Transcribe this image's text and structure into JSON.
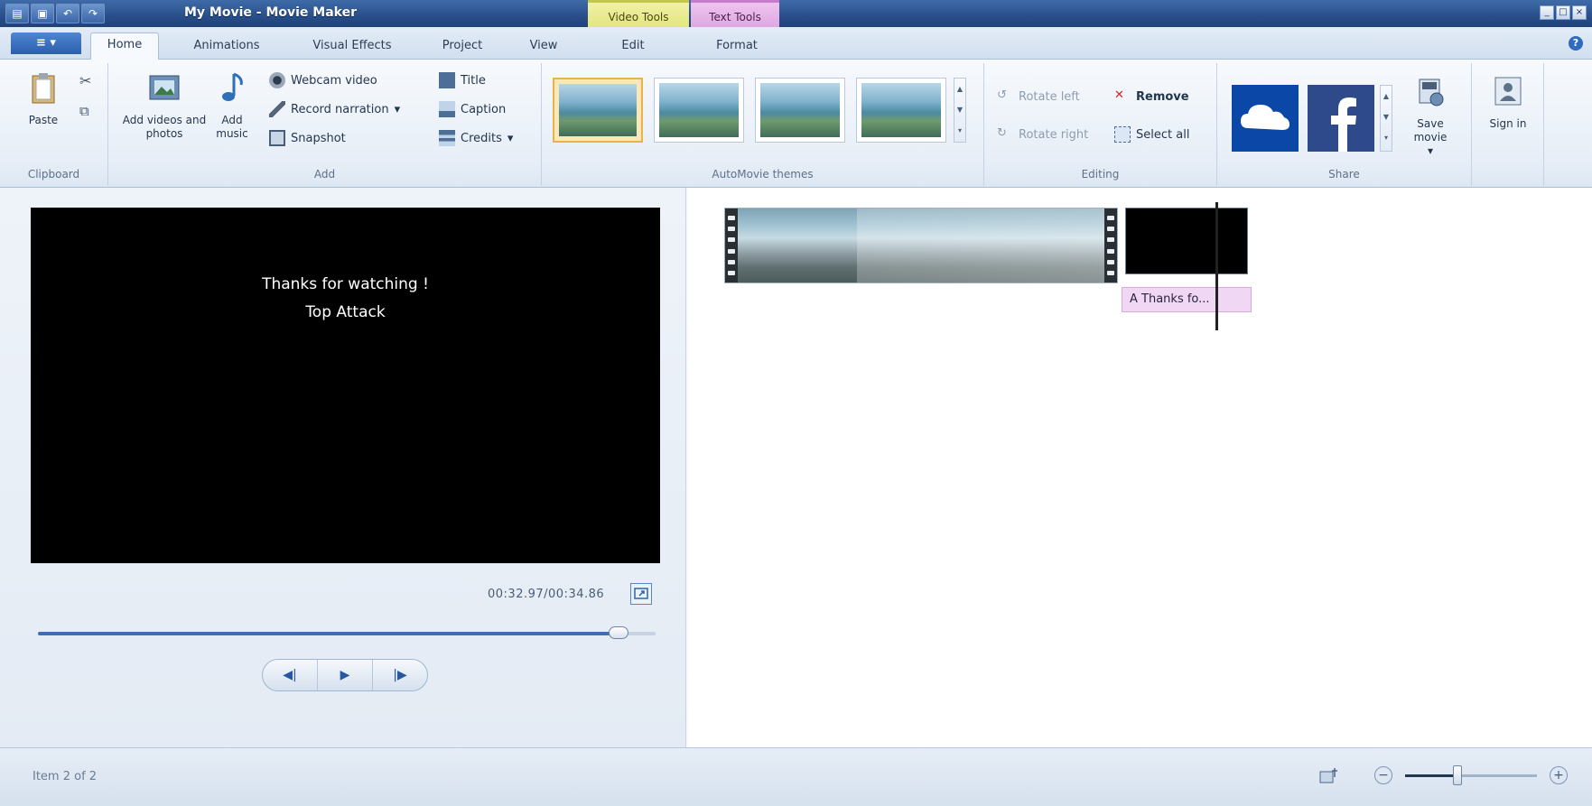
{
  "window": {
    "title": "My Movie - Movie Maker",
    "qat_icons": [
      "app-menu-icon",
      "save-icon",
      "undo-icon",
      "redo-icon"
    ],
    "context_tabs": {
      "video_tools": "Video Tools",
      "text_tools": "Text Tools"
    },
    "controls": {
      "minimize": "_",
      "maximize": "□",
      "close": "×"
    }
  },
  "ribbon_tabs": {
    "file": "≡ ▾",
    "items": [
      "Home",
      "Animations",
      "Visual Effects",
      "Project",
      "View",
      "Edit",
      "Format"
    ],
    "active": "Home"
  },
  "groups": {
    "clipboard": {
      "label": "Clipboard",
      "paste": "Paste"
    },
    "add": {
      "label": "Add",
      "add_videos": "Add videos and photos",
      "add_music": "Add music",
      "webcam": "Webcam video",
      "narration": "Record narration",
      "snapshot": "Snapshot",
      "title": "Title",
      "caption": "Caption",
      "credits": "Credits"
    },
    "themes": {
      "label": "AutoMovie themes",
      "count": 4,
      "selected_index": 0
    },
    "editing": {
      "label": "Editing",
      "rotate_left": "Rotate left",
      "rotate_right": "Rotate right",
      "remove": "Remove",
      "select_all": "Select all"
    },
    "share": {
      "label": "Share",
      "save_movie": "Save movie",
      "sign_in": "Sign in"
    }
  },
  "preview": {
    "caption_line1": "Thanks for watching !",
    "caption_line2": "Top Attack",
    "timecode": "00:32.97/00:34.86",
    "seek_position": 0.94,
    "transport": [
      "◀|",
      "▶",
      "|▶"
    ]
  },
  "storyboard": {
    "title_overlay": "A Thanks fo..."
  },
  "status": {
    "item_text": "Item 2 of 2",
    "zoom_level": 0.4
  },
  "colors": {
    "video_tools": "#e2e57c",
    "text_tools": "#dca6e0",
    "accent": "#2a5fae",
    "onedrive": "#0a47a7",
    "facebook": "#2f4a8a"
  }
}
